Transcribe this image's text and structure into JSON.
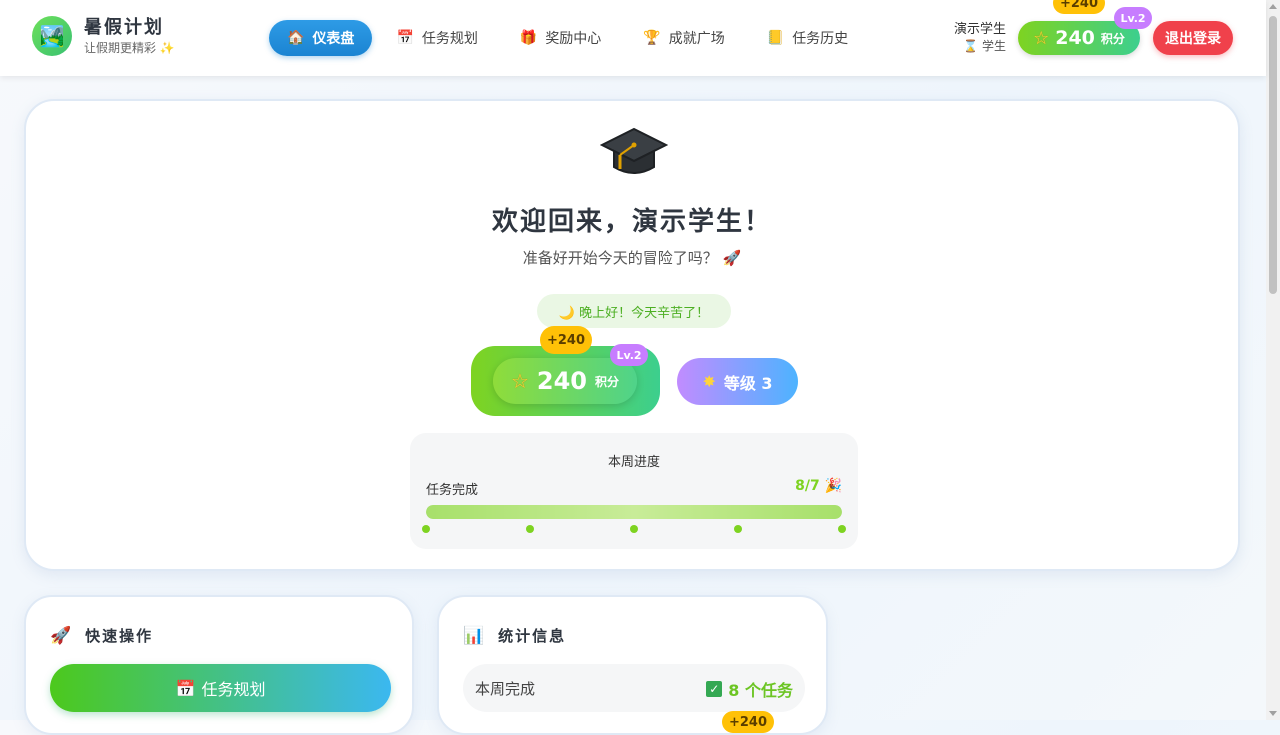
{
  "header": {
    "brand_title": "暑假计划",
    "brand_subtitle": "让假期更精彩 ✨",
    "nav": [
      {
        "label": "仪表盘",
        "icon": "home-icon",
        "active": true
      },
      {
        "label": "任务规划",
        "icon": "calendar-icon",
        "active": false
      },
      {
        "label": "奖励中心",
        "icon": "gift-icon",
        "active": false
      },
      {
        "label": "成就广场",
        "icon": "trophy-icon",
        "active": false
      },
      {
        "label": "任务历史",
        "icon": "ledger-icon",
        "active": false
      }
    ],
    "user_name": "演示学生",
    "user_role": "⌛ 学生",
    "points": "240",
    "points_unit": "积分",
    "points_bubble": "+240",
    "level_badge": "Lv.2",
    "logout_label": "退出登录"
  },
  "hero": {
    "title": "欢迎回来，演示学生！",
    "subtitle": "准备好开始今天的冒险了吗？ 🚀",
    "greeting": "🌙 晚上好！今天辛苦了！",
    "points": "240",
    "points_unit": "积分",
    "points_bubble": "+240",
    "level_badge": "Lv.2",
    "level_label": "等级 3",
    "progress": {
      "title": "本周进度",
      "label": "任务完成",
      "count": "8/7 🎉",
      "fraction": 1.0,
      "milestones": 5
    }
  },
  "quick_actions": {
    "title": "快速操作",
    "button_label": "任务规划"
  },
  "stats": {
    "title": "统计信息",
    "row_label": "本周完成",
    "row_value": "8 个任务",
    "bubble": "+240"
  },
  "colors": {
    "nav_active": "#1b84d2",
    "points_gradient_start": "#7ed321",
    "points_gradient_end": "#3ccf8e",
    "logout": "#f0414b",
    "level_gradient_start": "#c18cff",
    "level_gradient_end": "#4db3ff",
    "bubble": "#ffc107",
    "level_badge": "#c77dff"
  }
}
